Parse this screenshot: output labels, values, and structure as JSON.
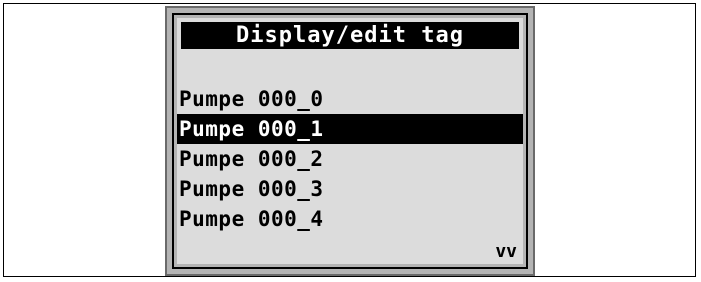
{
  "screen": {
    "title": "Display/edit tag",
    "tags": [
      {
        "label": "Pumpe 000_0",
        "selected": false
      },
      {
        "label": "Pumpe 000_1",
        "selected": true
      },
      {
        "label": "Pumpe 000_2",
        "selected": false
      },
      {
        "label": "Pumpe 000_3",
        "selected": false
      },
      {
        "label": "Pumpe 000_4",
        "selected": false
      }
    ],
    "scroll_indicator": "vv"
  },
  "colors": {
    "lcd_background": "#dcdcdc",
    "selection": "#000000",
    "bezel": "#b4b4b4"
  }
}
